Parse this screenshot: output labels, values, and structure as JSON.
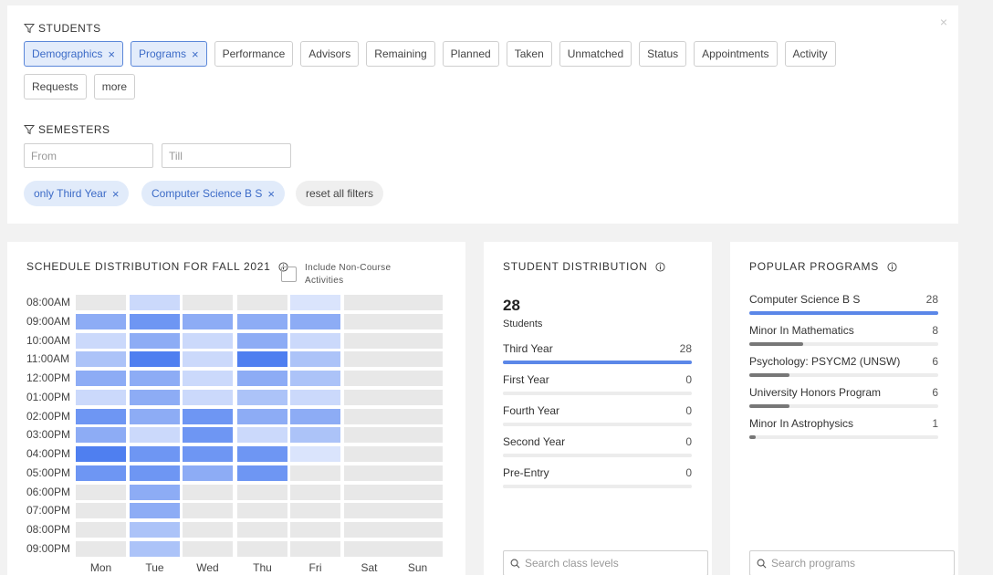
{
  "filters": {
    "students_heading": "STUDENTS",
    "close_icon": "×",
    "student_chips": [
      {
        "label": "Demographics",
        "active": true
      },
      {
        "label": "Programs",
        "active": true
      },
      {
        "label": "Performance",
        "active": false
      },
      {
        "label": "Advisors",
        "active": false
      },
      {
        "label": "Remaining",
        "active": false
      },
      {
        "label": "Planned",
        "active": false
      },
      {
        "label": "Taken",
        "active": false
      },
      {
        "label": "Unmatched",
        "active": false
      },
      {
        "label": "Status",
        "active": false
      },
      {
        "label": "Appointments",
        "active": false
      },
      {
        "label": "Activity",
        "active": false
      },
      {
        "label": "Requests",
        "active": false
      },
      {
        "label": "more",
        "active": false
      }
    ],
    "remove_icon": "×",
    "semesters_heading": "SEMESTERS",
    "from_placeholder": "From",
    "till_placeholder": "Till",
    "applied": [
      "only Third Year",
      "Computer Science B S"
    ],
    "reset_label": "reset all filters"
  },
  "schedule": {
    "title": "SCHEDULE DISTRIBUTION FOR FALL 2021",
    "include_label": "Include Non-Course Activities",
    "times": [
      "08:00AM",
      "09:00AM",
      "10:00AM",
      "11:00AM",
      "12:00PM",
      "01:00PM",
      "02:00PM",
      "03:00PM",
      "04:00PM",
      "05:00PM",
      "06:00PM",
      "07:00PM",
      "08:00PM",
      "09:00PM"
    ],
    "days": [
      "Mon",
      "Tue",
      "Wed",
      "Thu",
      "Fri",
      "Sat",
      "Sun"
    ],
    "intensity": [
      [
        0,
        1,
        0,
        0,
        0.5,
        0,
        0
      ],
      [
        3,
        4,
        3,
        3,
        3,
        0,
        0
      ],
      [
        1,
        3,
        1,
        3,
        1,
        0,
        0
      ],
      [
        2,
        5,
        1,
        5,
        2,
        0,
        0
      ],
      [
        3,
        3,
        1,
        3,
        2,
        0,
        0
      ],
      [
        1,
        3,
        1,
        2,
        1,
        0,
        0
      ],
      [
        4,
        3,
        4,
        3,
        3,
        0,
        0
      ],
      [
        3,
        1,
        4,
        1,
        2,
        0,
        0
      ],
      [
        5,
        4,
        4,
        4,
        0.5,
        0,
        0
      ],
      [
        4,
        4,
        3,
        4,
        0,
        0,
        0
      ],
      [
        0,
        3,
        0,
        0,
        0,
        0,
        0
      ],
      [
        0,
        3,
        0,
        0,
        0,
        0,
        0
      ],
      [
        0,
        2,
        0,
        0,
        0,
        0,
        0
      ],
      [
        0,
        2,
        0,
        0,
        0,
        0,
        0
      ]
    ],
    "colors": {
      "empty": "#e8e8e8",
      "accent": "#4f7ff0"
    }
  },
  "distribution": {
    "title": "STUDENT DISTRIBUTION",
    "total": "28",
    "total_label": "Students",
    "items": [
      {
        "label": "Third Year",
        "value": 28
      },
      {
        "label": "First Year",
        "value": 0
      },
      {
        "label": "Fourth Year",
        "value": 0
      },
      {
        "label": "Second Year",
        "value": 0
      },
      {
        "label": "Pre-Entry",
        "value": 0
      }
    ],
    "max": 28,
    "bar_color": "#5b87e8",
    "search_placeholder": "Search class levels"
  },
  "programs": {
    "title": "POPULAR PROGRAMS",
    "items": [
      {
        "label": "Computer Science B S",
        "value": 28
      },
      {
        "label": "Minor In Mathematics",
        "value": 8
      },
      {
        "label": "Psychology: PSYCM2 (UNSW)",
        "value": 6
      },
      {
        "label": "University Honors Program",
        "value": 6
      },
      {
        "label": "Minor In Astrophysics",
        "value": 1
      }
    ],
    "max": 28,
    "lead_color": "#5b87e8",
    "other_color": "#777777",
    "search_placeholder": "Search programs"
  }
}
